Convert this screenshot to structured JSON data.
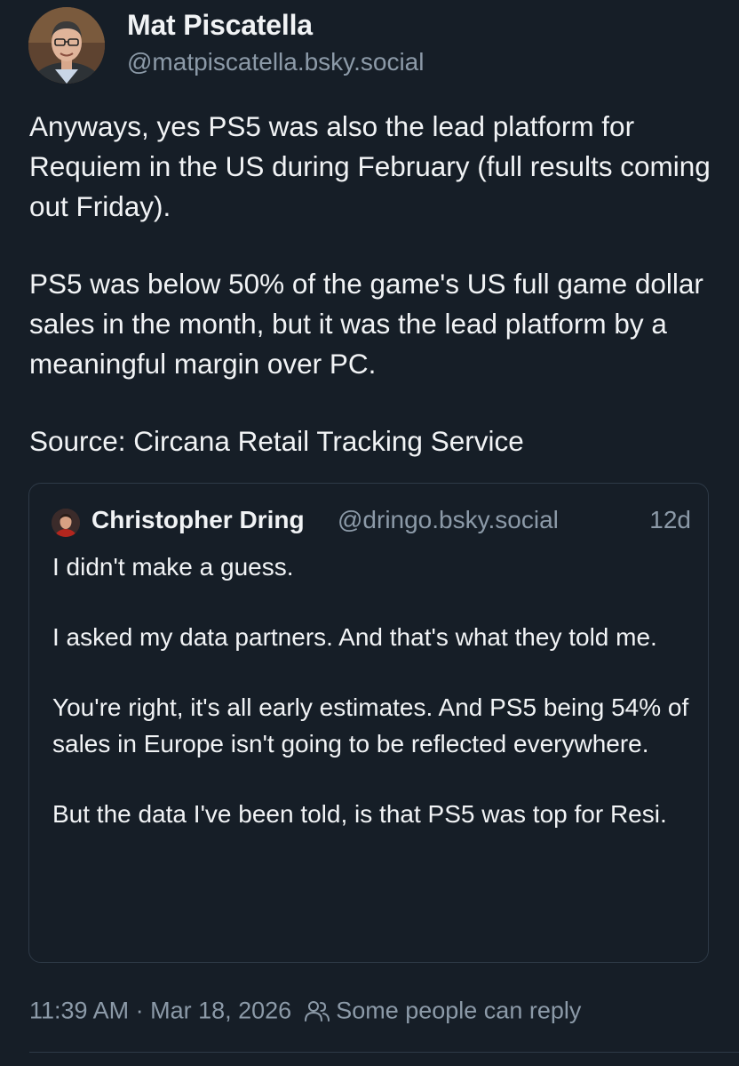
{
  "author": {
    "display_name": "Mat Piscatella",
    "handle": "@matpiscatella.bsky.social"
  },
  "post": {
    "paragraphs": [
      "Anyways, yes PS5 was also the lead platform for Requiem in the US during February (full results coming out Friday).",
      "PS5 was below 50% of the game's US full game dollar sales in the month, but it was the lead platform by a meaningful margin over PC.",
      "Source: Circana Retail Tracking Service"
    ]
  },
  "quote": {
    "display_name": "Christopher Dring",
    "handle": "@dringo.bsky.social",
    "age": "12d",
    "paragraphs": [
      "I didn't make a guess.",
      "I asked my data partners. And that's what they told me.",
      "You're right, it's all early estimates. And PS5 being 54% of sales in Europe isn't going to be reflected everywhere.",
      "But the data I've been told, is that PS5 was top for Resi."
    ]
  },
  "meta": {
    "time": "11:39 AM",
    "separator": " · ",
    "date": "Mar 18, 2026",
    "reply_icon": "people-icon",
    "reply_setting": "Some people can reply"
  },
  "colors": {
    "background": "#161e27",
    "text": "#f1f3f5",
    "muted": "#8c9aa8",
    "border": "#2e3a47"
  }
}
